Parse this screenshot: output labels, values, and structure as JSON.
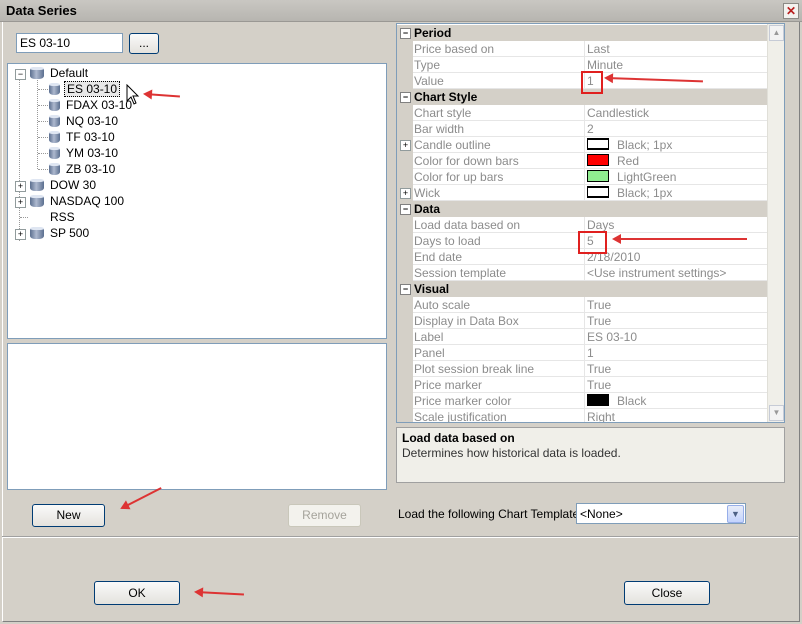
{
  "window": {
    "title": "Data Series",
    "close_glyph": "✕"
  },
  "instrument": {
    "value": "ES 03-10",
    "browse_label": "..."
  },
  "tree": {
    "root": {
      "label": "Default",
      "children": [
        {
          "label": "ES 03-10",
          "selected": true
        },
        {
          "label": "FDAX 03-10"
        },
        {
          "label": "NQ 03-10"
        },
        {
          "label": "TF 03-10"
        },
        {
          "label": "YM 03-10"
        },
        {
          "label": "ZB 03-10"
        }
      ]
    },
    "others": [
      {
        "label": "DOW 30",
        "expandable": true
      },
      {
        "label": "NASDAQ 100",
        "expandable": true
      },
      {
        "label": "RSS",
        "expandable": false
      },
      {
        "label": "SP 500",
        "expandable": true
      }
    ]
  },
  "buttons": {
    "new": "New",
    "remove": "Remove",
    "ok": "OK",
    "close": "Close"
  },
  "properties": {
    "period": {
      "title": "Period",
      "rows": [
        {
          "name": "Price based on",
          "value": "Last"
        },
        {
          "name": "Type",
          "value": "Minute"
        },
        {
          "name": "Value",
          "value": "1"
        }
      ]
    },
    "chart_style": {
      "title": "Chart Style",
      "rows": [
        {
          "name": "Chart style",
          "value": "Candlestick"
        },
        {
          "name": "Bar width",
          "value": "2"
        },
        {
          "name": "Candle outline",
          "value": "Black; 1px",
          "swatch": "#ffffff",
          "swatch_kind": "line"
        },
        {
          "name": "Color for down bars",
          "value": "Red",
          "swatch": "#ff0000"
        },
        {
          "name": "Color for up bars",
          "value": "LightGreen",
          "swatch": "#90ee90"
        },
        {
          "name": "Wick",
          "value": "Black; 1px",
          "swatch": "#ffffff",
          "swatch_kind": "line"
        }
      ]
    },
    "data": {
      "title": "Data",
      "rows": [
        {
          "name": "Load data based on",
          "value": "Days"
        },
        {
          "name": "Days to load",
          "value": "5"
        },
        {
          "name": "End date",
          "value": "2/18/2010"
        },
        {
          "name": "Session template",
          "value": "<Use instrument settings>"
        }
      ]
    },
    "visual": {
      "title": "Visual",
      "rows": [
        {
          "name": "Auto scale",
          "value": "True"
        },
        {
          "name": "Display in Data Box",
          "value": "True"
        },
        {
          "name": "Label",
          "value": "ES 03-10"
        },
        {
          "name": "Panel",
          "value": "1"
        },
        {
          "name": "Plot session break line",
          "value": "True"
        },
        {
          "name": "Price marker",
          "value": "True"
        },
        {
          "name": "Price marker color",
          "value": "Black",
          "swatch": "#000000"
        },
        {
          "name": "Scale justification",
          "value": "Right"
        }
      ]
    }
  },
  "help": {
    "title": "Load data based on",
    "text": "Determines how historical data is loaded."
  },
  "template": {
    "label": "Load the following Chart Template:",
    "value": "<None>"
  },
  "colors": {
    "annotation": "#e0201f",
    "selection_border": "#000000"
  }
}
